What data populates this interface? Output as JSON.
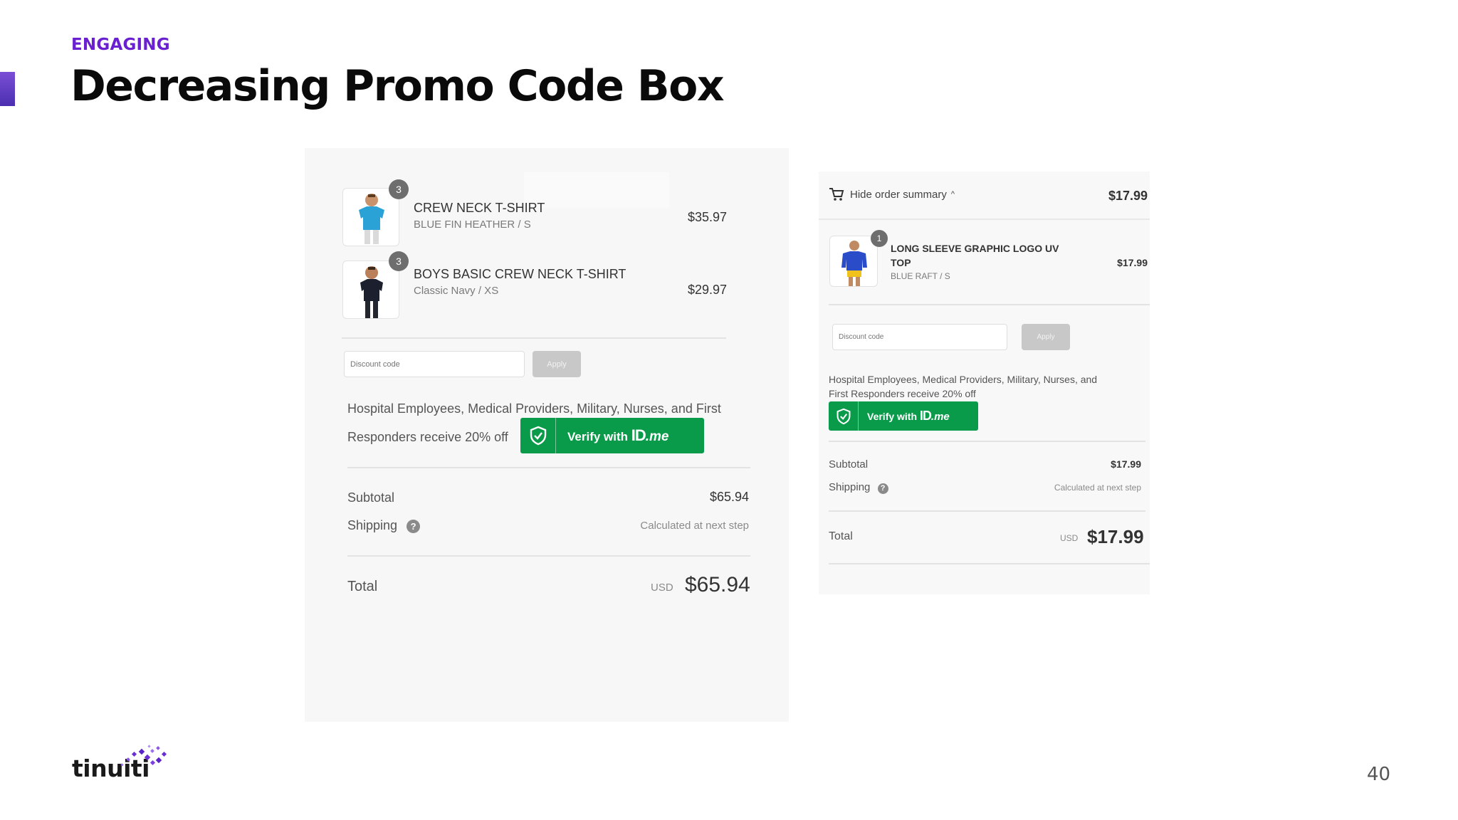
{
  "slide": {
    "eyebrow": "ENGAGING",
    "title": "Decreasing Promo Code Box",
    "page_number": "40",
    "logo_text": "tinuiti",
    "accent_color": "#6a1fd0"
  },
  "left_checkout": {
    "items": [
      {
        "qty": "3",
        "name": "CREW NECK T-SHIRT",
        "variant": "BLUE FIN HEATHER / S",
        "price": "$35.97"
      },
      {
        "qty": "3",
        "name": "BOYS BASIC CREW NECK T-SHIRT",
        "variant": "Classic Navy / XS",
        "price": "$29.97"
      }
    ],
    "discount_placeholder": "Discount code",
    "apply_label": "Apply",
    "promo_note_line1": "Hospital Employees, Medical Providers, Military, Nurses, and First",
    "promo_note_line2": "Responders receive 20% off",
    "verify": {
      "prefix": "Verify with ",
      "brand": "ID",
      "brand_suffix": ".me",
      "color": "#0a9b4a"
    },
    "subtotal_label": "Subtotal",
    "subtotal_value": "$65.94",
    "shipping_label": "Shipping",
    "shipping_value": "Calculated at next step",
    "help_glyph": "?",
    "total_label": "Total",
    "currency": "USD",
    "total_value": "$65.94"
  },
  "right_checkout": {
    "summary_toggle": "Hide order summary",
    "summary_total": "$17.99",
    "items": [
      {
        "qty": "1",
        "name_line1": "LONG SLEEVE GRAPHIC LOGO UV",
        "name_line2": "TOP",
        "variant": "BLUE RAFT / S",
        "price": "$17.99"
      }
    ],
    "discount_placeholder": "Discount code",
    "apply_label": "Apply",
    "promo_note_line1": "Hospital Employees, Medical Providers, Military, Nurses, and",
    "promo_note_line2": "First Responders receive 20% off",
    "verify": {
      "prefix": "Verify with ",
      "brand": "ID",
      "brand_suffix": ".me"
    },
    "subtotal_label": "Subtotal",
    "subtotal_value": "$17.99",
    "shipping_label": "Shipping",
    "shipping_value": "Calculated at next step",
    "help_glyph": "?",
    "total_label": "Total",
    "currency": "USD",
    "total_value": "$17.99"
  }
}
